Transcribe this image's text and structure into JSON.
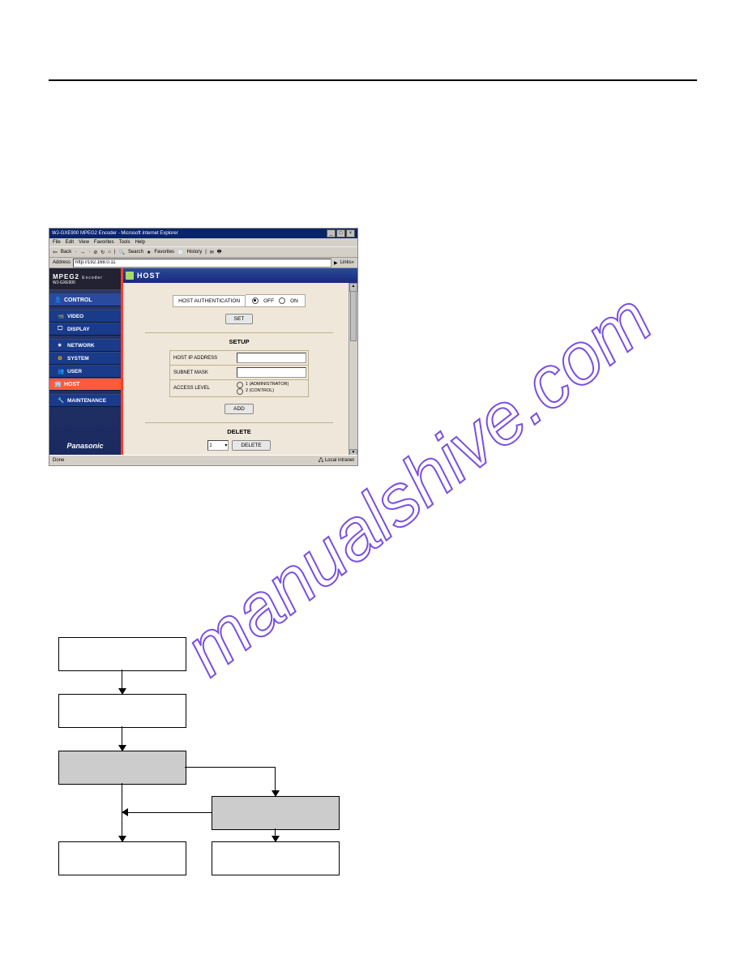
{
  "browser": {
    "window_title": "WJ-GXE900 MPEG2 Encoder - Microsoft Internet Explorer",
    "menus": [
      "File",
      "Edit",
      "View",
      "Favorites",
      "Tools",
      "Help"
    ],
    "toolbar": {
      "back": "Back",
      "search": "Search",
      "favorites": "Favorites",
      "history": "History"
    },
    "address_label": "Address",
    "address_value": "http://192.168.0.11",
    "links_label": "Links",
    "status_left": "Done",
    "status_right": "Local intranet"
  },
  "sidebar": {
    "product_line1": "MPEG2",
    "product_line2": "Encoder",
    "model": "WJ-GXE900",
    "items": [
      {
        "label": "CONTROL",
        "type": "ctrl"
      },
      {
        "label": "VIDEO",
        "type": "sub"
      },
      {
        "label": "DISPLAY",
        "type": "sub"
      },
      {
        "label": "NETWORK",
        "type": "sub"
      },
      {
        "label": "SYSTEM",
        "type": "sub"
      },
      {
        "label": "USER",
        "type": "sub"
      },
      {
        "label": "HOST",
        "type": "active"
      },
      {
        "label": "MAINTENANCE",
        "type": "sub"
      }
    ],
    "brand": "Panasonic"
  },
  "main": {
    "header": "HOST",
    "auth_label": "HOST AUTHENTICATION",
    "opt_off": "OFF",
    "opt_on": "ON",
    "btn_set": "SET",
    "setup_title": "SETUP",
    "field_ip": "HOST IP ADDRESS",
    "field_subnet": "SUBNET MASK",
    "field_access": "ACCESS LEVEL",
    "access_opt1": "1 (ADMINISTRATOR)",
    "access_opt2": "2 (CONTROL)",
    "btn_add": "ADD",
    "delete_title": "DELETE",
    "delete_select_value": "1",
    "btn_delete": "DELETE"
  },
  "watermark_text": "manualshive.com"
}
